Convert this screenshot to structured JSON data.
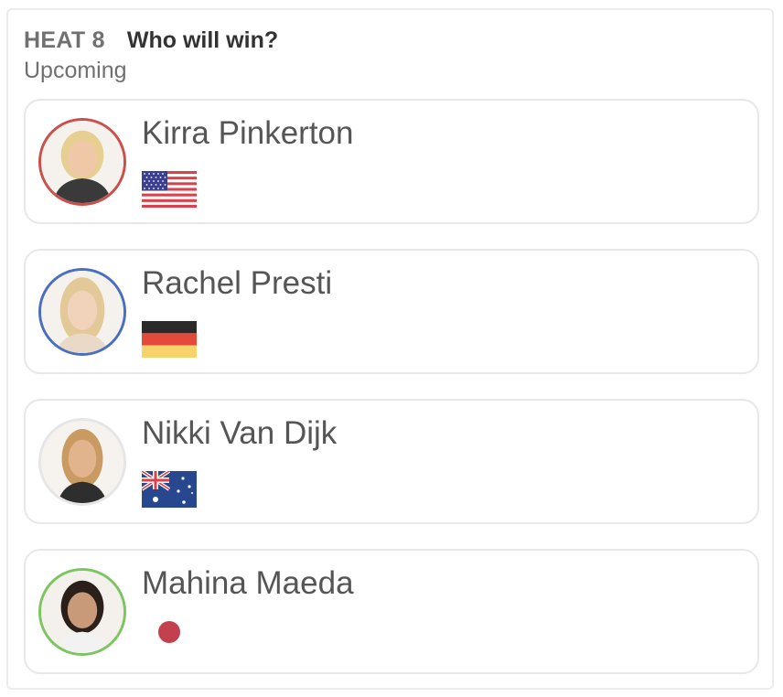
{
  "heat": {
    "label": "HEAT 8",
    "question": "Who will win?",
    "status": "Upcoming"
  },
  "surfers": [
    {
      "name": "Kirra Pinkerton",
      "ring_color": "#c9504d",
      "flag_icon": "usa-flag-icon",
      "hair": "#e7cf92",
      "skin": "#efc8a8"
    },
    {
      "name": "Rachel Presti",
      "ring_color": "#4a6fc1",
      "flag_icon": "germany-flag-icon",
      "hair": "#e3c997",
      "skin": "#f1d3bb"
    },
    {
      "name": "Nikki Van Dijk",
      "ring_color": "#e6e6e6",
      "flag_icon": "australia-flag-icon",
      "hair": "#c99b63",
      "skin": "#e2b48d"
    },
    {
      "name": "Mahina Maeda",
      "ring_color": "#7cc55f",
      "flag_icon": "japan-flag-icon",
      "hair": "#2b1f1a",
      "skin": "#c99a7a"
    }
  ]
}
